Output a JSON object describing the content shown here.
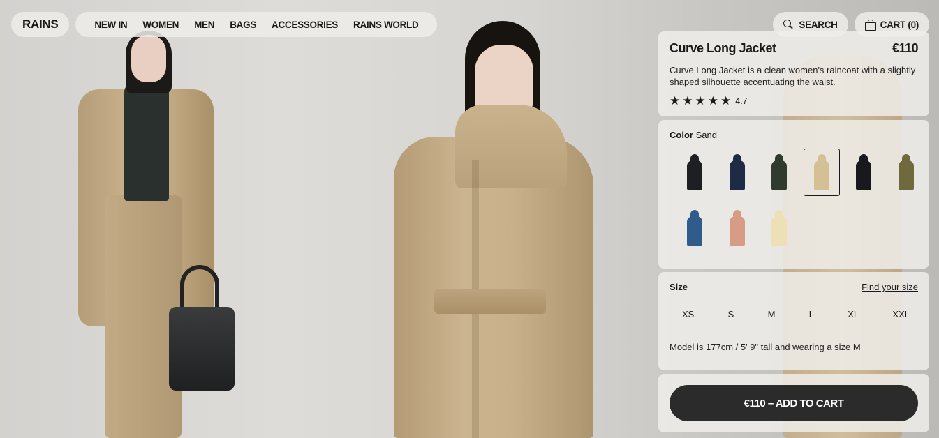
{
  "header": {
    "logo": "RAINS",
    "menu": [
      "NEW IN",
      "WOMEN",
      "MEN",
      "BAGS",
      "ACCESSORIES",
      "RAINS WORLD"
    ],
    "search_label": "SEARCH",
    "cart_label": "CART (0)"
  },
  "product": {
    "title": "Curve Long Jacket",
    "price": "€110",
    "description": "Curve Long Jacket is a clean women's raincoat with a slightly shaped silhouette accentuating the waist.",
    "rating": "4.7",
    "stars": 5
  },
  "color": {
    "label": "Color",
    "selected": "Sand",
    "swatches": [
      {
        "name": "black",
        "hex": "#1d1f22"
      },
      {
        "name": "navy",
        "hex": "#1f2a44"
      },
      {
        "name": "green",
        "hex": "#2f3b2e"
      },
      {
        "name": "sand",
        "hex": "#d5bf95",
        "selected": true
      },
      {
        "name": "black-2",
        "hex": "#18191c"
      },
      {
        "name": "olive",
        "hex": "#6f6a3e"
      },
      {
        "name": "blue",
        "hex": "#2f5c8a"
      },
      {
        "name": "rose",
        "hex": "#d79b86"
      },
      {
        "name": "cream",
        "hex": "#ede0b6"
      }
    ]
  },
  "size": {
    "label": "Size",
    "find_size": "Find your size",
    "options": [
      "XS",
      "S",
      "M",
      "L",
      "XL",
      "XXL"
    ],
    "model_info": "Model is 177cm / 5' 9\" tall and wearing a size M"
  },
  "cta": {
    "add_to_cart": "€110 – ADD TO CART"
  }
}
